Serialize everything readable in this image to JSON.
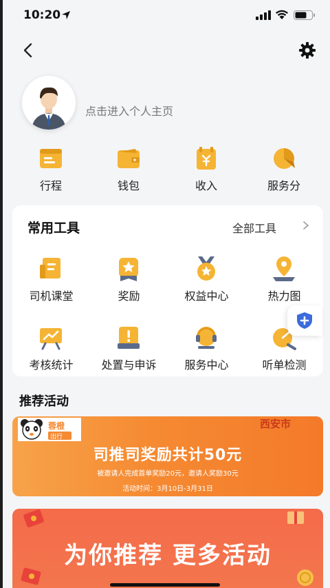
{
  "status_bar": {
    "time": "10:20"
  },
  "profile": {
    "link_text": "点击进入个人主页"
  },
  "quick_items": [
    {
      "label": "行程",
      "icon": "trip-icon"
    },
    {
      "label": "钱包",
      "icon": "wallet-icon"
    },
    {
      "label": "收入",
      "icon": "income-icon"
    },
    {
      "label": "服务分",
      "icon": "service-score-icon"
    }
  ],
  "tools": {
    "title": "常用工具",
    "all_label": "全部工具",
    "items": [
      {
        "label": "司机课堂",
        "icon": "driver-class-icon"
      },
      {
        "label": "奖励",
        "icon": "reward-icon"
      },
      {
        "label": "权益中心",
        "icon": "benefits-icon"
      },
      {
        "label": "热力图",
        "icon": "heatmap-icon"
      },
      {
        "label": "考核统计",
        "icon": "assessment-icon"
      },
      {
        "label": "处置与申诉",
        "icon": "appeal-icon"
      },
      {
        "label": "服务中心",
        "icon": "service-center-icon"
      },
      {
        "label": "听单检测",
        "icon": "order-check-icon"
      }
    ]
  },
  "recommend": {
    "title": "推荐活动",
    "banner1": {
      "logo_text": "蓉橙出行",
      "city": "西安市",
      "headline": "司推司奖励共计50元",
      "subline": "被邀请人完成首单奖励20元，邀请人奖励30元",
      "date": "活动时间：3月10日-3月31日"
    },
    "banner2": {
      "headline": "为你推荐  更多活动"
    }
  },
  "colors": {
    "accent_gold": "#f5b434",
    "accent_dark_gold": "#e29a1a",
    "banner_orange": "#f58a32",
    "shield_blue": "#3b6bdc"
  }
}
